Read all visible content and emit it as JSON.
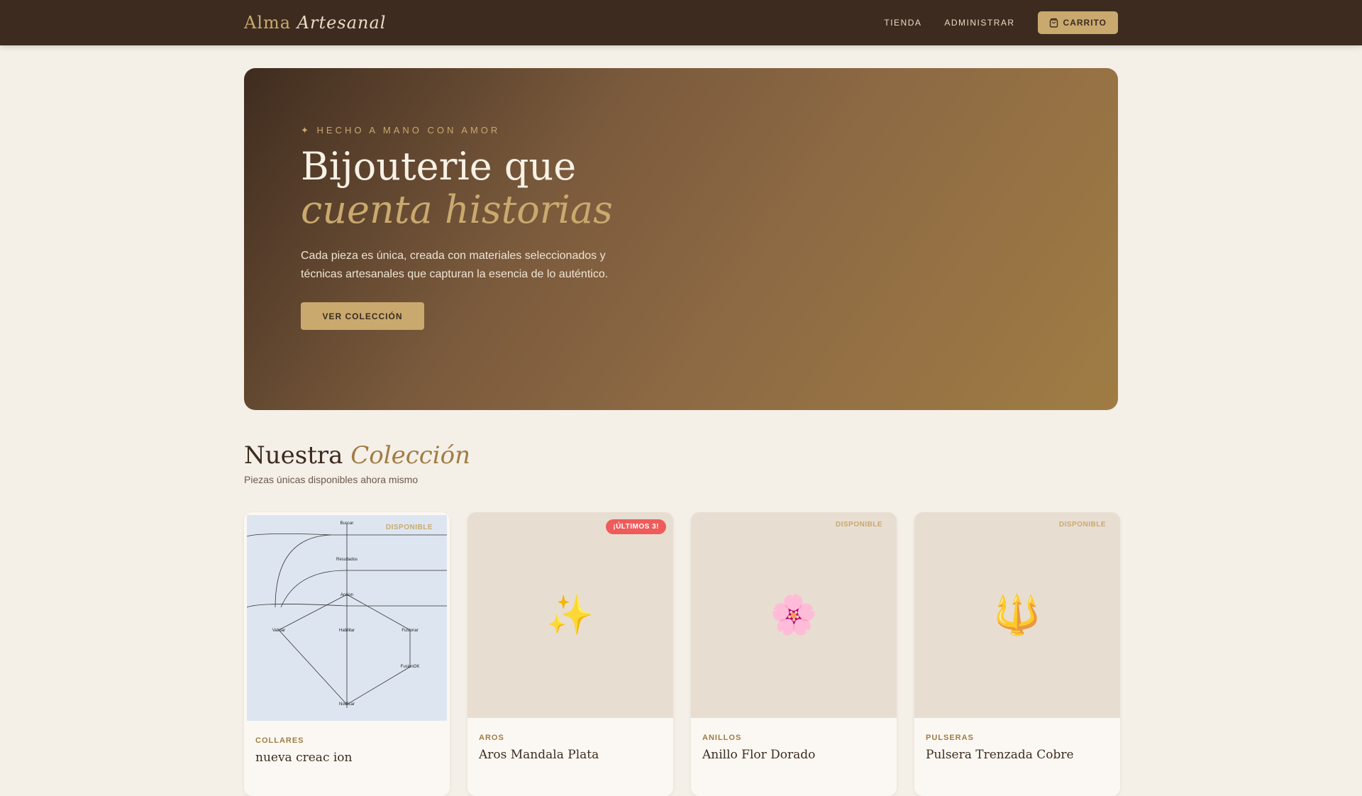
{
  "nav": {
    "logo_a": "Alma",
    "logo_b": "Artesanal",
    "links": [
      "TIENDA",
      "ADMINISTRAR"
    ],
    "cart": "CARRITO"
  },
  "hero": {
    "eyebrow": "✦ HECHO A MANO CON AMOR",
    "title_a": "Bijouterie que",
    "title_b": "cuenta historias",
    "text": "Cada pieza es única, creada con materiales seleccionados y técnicas artesanales que capturan la esencia de lo auténtico.",
    "button": "VER COLECCIÓN"
  },
  "section": {
    "title_a": "Nuestra",
    "title_b": "Colección",
    "subtitle": "Piezas únicas disponibles ahora mismo"
  },
  "diagram_labels": [
    "Buscar",
    "Resultados",
    "Accion",
    "Validar",
    "Habilitar",
    "Fusionar",
    "FusionOK",
    "Notificar"
  ],
  "products": [
    {
      "badge": "DISPONIBLE",
      "category": "COLLARES",
      "name": "nueva creac ion",
      "emoji": ""
    },
    {
      "badge": "¡ÚLTIMOS 3!",
      "category": "AROS",
      "name": "Aros Mandala Plata",
      "emoji": "✨"
    },
    {
      "badge": "DISPONIBLE",
      "category": "ANILLOS",
      "name": "Anillo Flor Dorado",
      "emoji": "🌸"
    },
    {
      "badge": "DISPONIBLE",
      "category": "PULSERAS",
      "name": "Pulsera Trenzada Cobre",
      "emoji": "🔱"
    }
  ]
}
